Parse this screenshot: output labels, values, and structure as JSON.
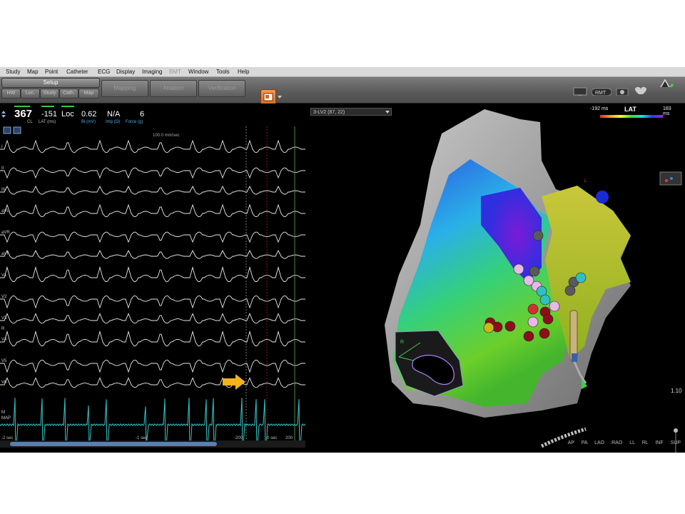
{
  "menu": {
    "items": [
      "Study",
      "Map",
      "Point",
      "Catheter",
      "ECG",
      "Display",
      "Imaging",
      "BMT",
      "Window",
      "Tools",
      "Help"
    ],
    "disabled": [
      "BMT"
    ]
  },
  "toolbar": {
    "setup_label": "Setup",
    "sub_tabs": [
      "HW",
      "Loc.",
      "Study",
      "Cath.",
      "Map"
    ],
    "workflow_tabs": [
      "Mapping",
      "Ablation",
      "Verification"
    ]
  },
  "vitals": {
    "cl": {
      "value": "367",
      "label": "CL"
    },
    "lat": {
      "value": "-151",
      "label": "LAT (ms)"
    },
    "loc": {
      "value": "Loc",
      "label": ""
    },
    "bi": {
      "value": "0.62",
      "label": "Bi (mV)"
    },
    "imp": {
      "value": "N/A",
      "label": "Imp (Ω)"
    },
    "force": {
      "value": "6",
      "label": "Force (g)"
    }
  },
  "ecg": {
    "sweep_speed": "100.0 mm/sec",
    "leads": [
      "I",
      "II",
      "III",
      "aVL",
      "aVR",
      "aVF",
      "V1",
      "V2",
      "V3",
      "V4",
      "V5",
      "V6"
    ],
    "map_channel_labels": [
      "M",
      "MAP"
    ],
    "ref_label": "R",
    "time_labels": [
      "-2 sec",
      "-1 sec",
      "-200",
      "0 sec",
      "200"
    ],
    "trace_color": "#e8e8e8",
    "map_trace_color": "#35c7c7",
    "arrow_color": "#f2b31b"
  },
  "map": {
    "selector_value": "3-LV2 (87, 22)",
    "legend": {
      "min": "-192 ms",
      "title": "LAT",
      "max": "183 ms"
    },
    "zoom_value": "1.10",
    "view_buttons": [
      "AP",
      "PA",
      "LAO",
      "RAO",
      "LL",
      "RL",
      "INF",
      "SUP"
    ],
    "catheter_label": "R",
    "tag_label": "L"
  }
}
